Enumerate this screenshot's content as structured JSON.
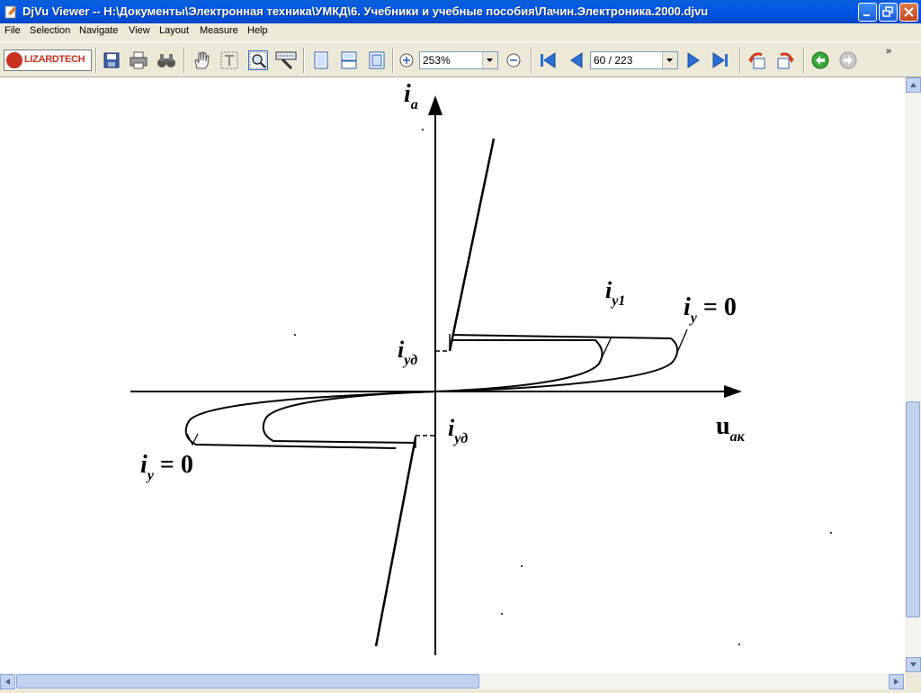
{
  "window": {
    "title": "DjVu Viewer -- H:\\Документы\\Электронная техника\\УМКД\\6. Учебники и учебные пособия\\Лачин.Электроника.2000.djvu"
  },
  "menu": {
    "items": [
      "File",
      "Selection",
      "Navigate",
      "View",
      "Layout",
      "Measure",
      "Help"
    ]
  },
  "toolbar": {
    "logo_text": "LIZARDTECH",
    "zoom_value": "253%",
    "page_value": "60 / 223",
    "overflow_glyph": "»"
  },
  "icons": {
    "save": "save-icon",
    "print": "print-icon",
    "find": "binoculars-icon",
    "hand": "hand-icon",
    "text_select": "text-select-icon",
    "zoom_tool": "zoom-tool-icon",
    "magnifier": "magnifier-icon",
    "single_page": "single-page-icon",
    "continuous": "continuous-icon",
    "fit_page": "fit-page-icon",
    "zoom_in": "zoom-in-icon",
    "zoom_out": "zoom-out-icon",
    "first_page": "first-page-icon",
    "prev_page": "prev-page-icon",
    "next_page": "next-page-icon",
    "last_page": "last-page-icon",
    "rotate_left": "rotate-left-icon",
    "rotate_right": "rotate-right-icon",
    "back": "back-icon",
    "forward": "forward-icon"
  },
  "colors": {
    "title_bar": "#0058e6",
    "chrome": "#ece9d8",
    "nav_blue": "#2b6fd6",
    "go_green": "#3aa83a"
  },
  "document": {
    "labels": {
      "ia_main": "i",
      "ia_sub": "a",
      "iud_top_main": "i",
      "iud_top_sub": "уд",
      "iy1_main": "i",
      "iy1_sub": "у1",
      "iy0_right_main": "i",
      "iy0_right_sub": "у",
      "iy0_right_eq": "= 0",
      "uak_main": "u",
      "uak_sub": "ак",
      "iud_bottom_main": "i",
      "iud_bottom_sub": "уд",
      "iy0_left_main": "i",
      "iy0_left_sub": "у",
      "iy0_left_eq": "= 0"
    }
  }
}
